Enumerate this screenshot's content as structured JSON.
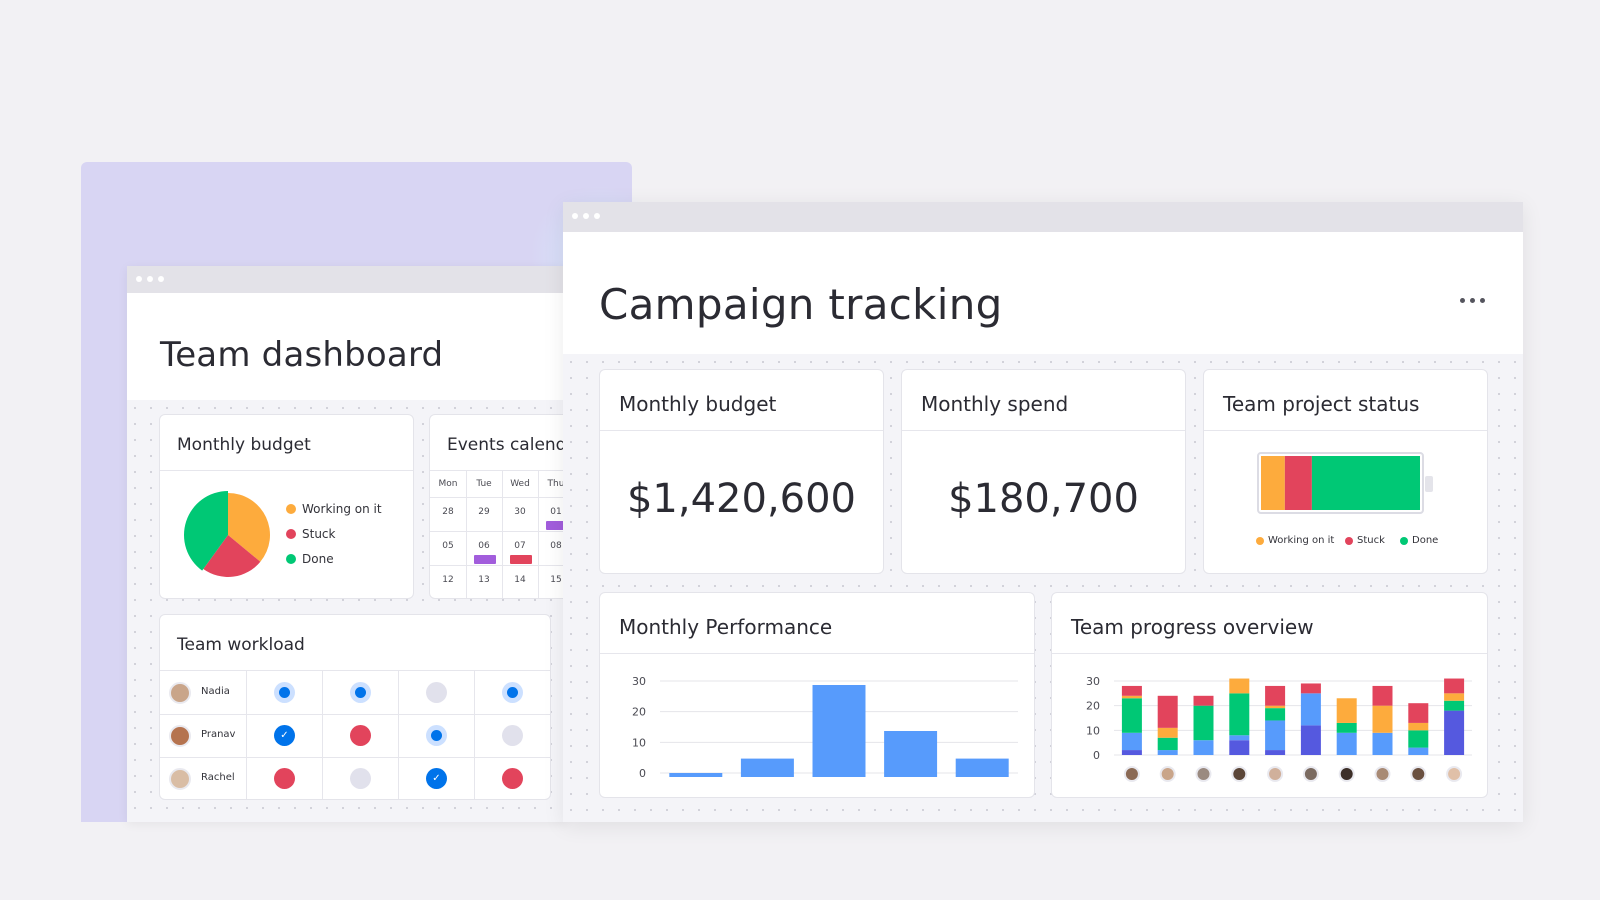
{
  "team_dashboard": {
    "title": "Team dashboard",
    "budget_card": {
      "title": "Monthly budget",
      "legend": [
        {
          "label": "Working on it",
          "color": "#fdab3d"
        },
        {
          "label": "Stuck",
          "color": "#e2445c"
        },
        {
          "label": "Done",
          "color": "#00c875"
        }
      ],
      "pie": [
        {
          "label": "Working on it",
          "value": 36,
          "color": "#fdab3d"
        },
        {
          "label": "Stuck",
          "value": 24,
          "color": "#e2445c"
        },
        {
          "label": "Done",
          "value": 40,
          "color": "#00c875"
        }
      ]
    },
    "events_card": {
      "title": "Events calendar",
      "days": [
        "Mon",
        "Tue",
        "Wed",
        "Thu"
      ],
      "weeks": [
        [
          "28",
          "29",
          "30",
          "01"
        ],
        [
          "05",
          "06",
          "07",
          "08"
        ],
        [
          "12",
          "13",
          "14",
          "15"
        ]
      ],
      "event_colors": {
        "purple": "#a25ddc",
        "red": "#e2445c"
      }
    },
    "workload_card": {
      "title": "Team workload",
      "people": [
        {
          "name": "Nadia",
          "statuses": [
            "ring",
            "ring",
            "empty",
            "ring"
          ]
        },
        {
          "name": "Pranav",
          "statuses": [
            "check",
            "red",
            "ring",
            "empty"
          ]
        },
        {
          "name": "Rachel",
          "statuses": [
            "red",
            "empty",
            "check",
            "red"
          ]
        }
      ],
      "colors": {
        "blue": "#0073ea",
        "red": "#e2445c",
        "empty": "#e1e1ec",
        "ring": "#cce0ff"
      }
    }
  },
  "campaign": {
    "title": "Campaign tracking",
    "more_icon": "more-horizontal-icon",
    "monthly_budget": {
      "title": "Monthly budget",
      "value": "$1,420,600"
    },
    "monthly_spend": {
      "title": "Monthly spend",
      "value": "$180,700"
    },
    "project_status": {
      "title": "Team project status",
      "segments": [
        {
          "label": "Working on it",
          "value": 15,
          "color": "#fdab3d"
        },
        {
          "label": "Stuck",
          "value": 17,
          "color": "#e2445c"
        },
        {
          "label": "Done",
          "value": 68,
          "color": "#00c875"
        }
      ]
    },
    "performance": {
      "title": "Monthly Performance",
      "chart_data": {
        "type": "bar",
        "values": [
          1,
          6,
          30,
          15,
          6
        ],
        "ylim": [
          0,
          30
        ],
        "yticks": [
          "30",
          "20",
          "10",
          "0"
        ],
        "color": "#579bfc"
      }
    },
    "progress": {
      "title": "Team progress overview",
      "chart_data": {
        "type": "bar",
        "stacked": true,
        "ylim": [
          0,
          30
        ],
        "yticks": [
          "30",
          "20",
          "10",
          "0"
        ],
        "series": [
          {
            "color": "#5559df",
            "values": [
              2,
              0,
              0,
              6,
              2,
              12,
              0,
              0,
              0,
              18
            ]
          },
          {
            "color": "#579bfc",
            "values": [
              7,
              2,
              6,
              2,
              12,
              13,
              9,
              9,
              3,
              0
            ]
          },
          {
            "color": "#00c875",
            "values": [
              14,
              5,
              14,
              17,
              5,
              0,
              4,
              0,
              7,
              4
            ]
          },
          {
            "color": "#fdab3d",
            "values": [
              1,
              4,
              0,
              6,
              1,
              0,
              10,
              11,
              3,
              3
            ]
          },
          {
            "color": "#e2445c",
            "values": [
              4,
              13,
              4,
              0,
              8,
              4,
              0,
              8,
              8,
              6
            ]
          }
        ]
      }
    }
  }
}
